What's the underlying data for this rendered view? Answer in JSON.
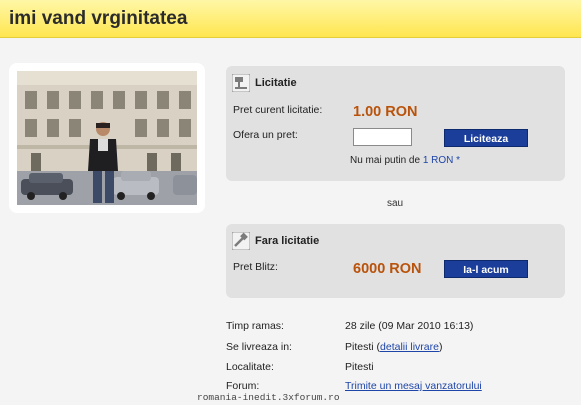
{
  "listing": {
    "title": "imi vand vrginitatea"
  },
  "auction": {
    "heading": "Licitatie",
    "current_price_label": "Pret curent licitatie:",
    "current_price": "1.00 RON",
    "offer_label": "Ofera un pret:",
    "offer_value": "",
    "bid_button": "Liciteaza",
    "min_note_prefix": "Nu mai putin de ",
    "min_note_amount": "1 RON *"
  },
  "separator": "sau",
  "buy_now": {
    "heading": "Fara licitatie",
    "price_label": "Pret Blitz:",
    "price": "6000 RON",
    "button": "Ia-l acum"
  },
  "details": {
    "time_label": "Timp ramas:",
    "time_value": "28 zile (09 Mar 2010 16:13)",
    "ship_label": "Se livreaza in:",
    "ship_city": "Pitesti (",
    "ship_link": "detalii livrare",
    "ship_close": ")",
    "location_label": "Localitate:",
    "location_value": "Pitesti",
    "forum_label": "Forum:",
    "forum_link": "Trimite un mesaj vanzatorului"
  },
  "watermark": "romania-inedit.3xforum.ro",
  "colors": {
    "title_bar": "#ffe650",
    "price": "#b9530c",
    "button": "#1b3e9a",
    "link": "#1e45a8",
    "panel": "#e1e1e1"
  },
  "icons": [
    "gavel-icon",
    "hammer-icon"
  ]
}
